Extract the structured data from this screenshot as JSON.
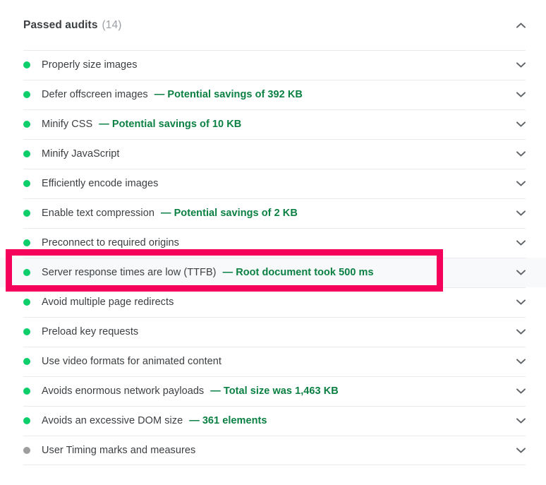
{
  "header": {
    "title": "Passed audits",
    "count": "(14)",
    "collapse_icon": "chevron-up-icon"
  },
  "row_icons": {
    "expand": "chevron-down-icon"
  },
  "colors": {
    "pass_dot": "#0cce6b",
    "not_applicable_dot": "#9e9e9e",
    "detail_text": "#0b8043",
    "title_text": "#3c4043",
    "count_text": "#9aa0a6",
    "divider": "#e8eaed",
    "row_hover_bg": "#f8f9fa",
    "highlight_border": "#f5005a"
  },
  "audits": [
    {
      "status": "pass",
      "title": "Properly size images",
      "detail": ""
    },
    {
      "status": "pass",
      "title": "Defer offscreen images",
      "detail": "— Potential savings of 392 KB"
    },
    {
      "status": "pass",
      "title": "Minify CSS",
      "detail": "— Potential savings of 10 KB"
    },
    {
      "status": "pass",
      "title": "Minify JavaScript",
      "detail": ""
    },
    {
      "status": "pass",
      "title": "Efficiently encode images",
      "detail": ""
    },
    {
      "status": "pass",
      "title": "Enable text compression",
      "detail": "— Potential savings of 2 KB"
    },
    {
      "status": "pass",
      "title": "Preconnect to required origins",
      "detail": ""
    },
    {
      "status": "pass",
      "title": "Server response times are low (TTFB)",
      "detail": "— Root document took 500 ms"
    },
    {
      "status": "pass",
      "title": "Avoid multiple page redirects",
      "detail": ""
    },
    {
      "status": "pass",
      "title": "Preload key requests",
      "detail": ""
    },
    {
      "status": "pass",
      "title": "Use video formats for animated content",
      "detail": ""
    },
    {
      "status": "pass",
      "title": "Avoids enormous network payloads",
      "detail": "— Total size was 1,463 KB"
    },
    {
      "status": "pass",
      "title": "Avoids an excessive DOM size",
      "detail": "— 361 elements"
    },
    {
      "status": "notapp",
      "title": "User Timing marks and measures",
      "detail": ""
    }
  ],
  "highlight": {
    "target_index": 7,
    "annotation_name": "server-response-times-highlight"
  }
}
